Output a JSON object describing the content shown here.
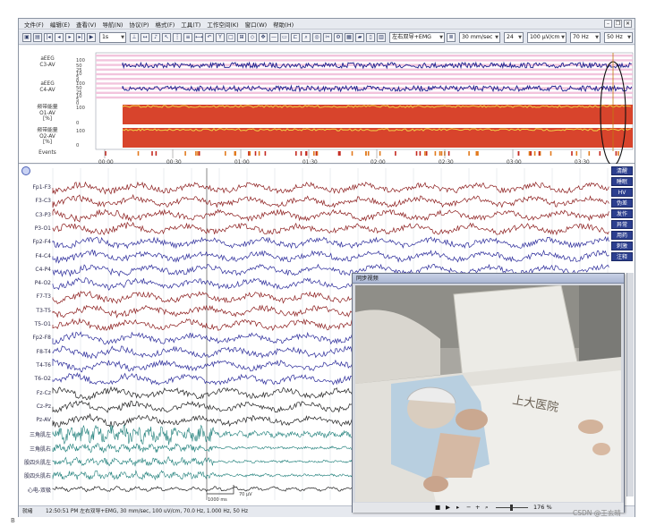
{
  "menubar": {
    "items": [
      "文件(F)",
      "编辑(E)",
      "查看(V)",
      "导航(N)",
      "协议(P)",
      "格式(F)",
      "工具(T)",
      "工作空间(K)",
      "窗口(W)",
      "帮助(H)"
    ]
  },
  "toolbar": {
    "page_select": "1s",
    "montage_select": "左右双导+EMG",
    "speed_select": "30 mm/sec",
    "channel_count_select": "24",
    "sensitivity_select": "100 μV/cm",
    "lowpass_select": "70 Hz",
    "notch_select": "50 Hz"
  },
  "trend": {
    "rows": [
      {
        "label": "aEEG\nC3-AV",
        "ticks": [
          "100",
          "50",
          "25",
          "10",
          "5",
          "0"
        ]
      },
      {
        "label": "aEEG\nC4-AV",
        "ticks": [
          "100",
          "50",
          "25",
          "10",
          "5",
          "0"
        ]
      },
      {
        "label": "频带能量\nO1-AV\n[%]",
        "ticks": [
          "100",
          "0"
        ]
      },
      {
        "label": "频带能量\nO2-AV\n[%]",
        "ticks": [
          "100",
          "0"
        ]
      },
      {
        "label": "Events",
        "ticks": []
      }
    ],
    "time_axis": [
      "00:00",
      "00:30",
      "01:00",
      "01:30",
      "02:00",
      "02:30",
      "03:00",
      "03:30"
    ]
  },
  "eeg": {
    "channels": [
      {
        "label": "Fp1-F3",
        "color": "#8b1a1a"
      },
      {
        "label": "F3-C3",
        "color": "#8b1a1a"
      },
      {
        "label": "C3-P3",
        "color": "#8b1a1a"
      },
      {
        "label": "P3-O1",
        "color": "#8b1a1a"
      },
      {
        "label": "Fp2-F4",
        "color": "#2a2a9a"
      },
      {
        "label": "F4-C4",
        "color": "#2a2a9a"
      },
      {
        "label": "C4-P4",
        "color": "#2a2a9a"
      },
      {
        "label": "P4-O2",
        "color": "#2a2a9a"
      },
      {
        "label": "F7-T3",
        "color": "#8b1a1a"
      },
      {
        "label": "T3-T5",
        "color": "#8b1a1a"
      },
      {
        "label": "T5-O1",
        "color": "#8b1a1a"
      },
      {
        "label": "Fp2-F8",
        "color": "#2a2a9a"
      },
      {
        "label": "F8-T4",
        "color": "#2a2a9a"
      },
      {
        "label": "T4-T6",
        "color": "#2a2a9a"
      },
      {
        "label": "T6-O2",
        "color": "#2a2a9a"
      },
      {
        "label": "Fz-Cz",
        "color": "#222222"
      },
      {
        "label": "Cz-Pz",
        "color": "#222222"
      },
      {
        "label": "Pz-AV",
        "color": "#222222"
      },
      {
        "label": "三角肌左",
        "color": "#1f7f7a"
      },
      {
        "label": "三角肌右",
        "color": "#1f7f7a"
      },
      {
        "label": "股四头肌左",
        "color": "#1f7f7a"
      },
      {
        "label": "股四头肌右",
        "color": "#1f7f7a"
      },
      {
        "label": "心电-双极",
        "color": "#222222"
      }
    ],
    "side_buttons": [
      "清醒",
      "睡眠",
      "HV",
      "伪差",
      "发作",
      "异常",
      "用药",
      "刺激",
      "注释"
    ],
    "scale_label": "1000 ms",
    "amplitude_label": "70 μV"
  },
  "status": {
    "left": "就绪",
    "main": "12:50:51 PM 左右双导+EMG, 30 mm/sec, 100 uV/cm, 70.0 Hz, 1.000 Hz, 50 Hz"
  },
  "video": {
    "title": "同步视频",
    "zoom": "176 %",
    "bed_text": "上大医院"
  },
  "footer": {
    "letter": "B",
    "watermark": "CSDN @王玄晴"
  },
  "colors": {
    "eeg_red": "#8b1a1a",
    "eeg_blue": "#2a2a9a",
    "emg_teal": "#1f7f7a",
    "band_red": "#d8442c",
    "aeeg_blue": "#1b1f8f",
    "side_button": "#2c3f8f"
  }
}
